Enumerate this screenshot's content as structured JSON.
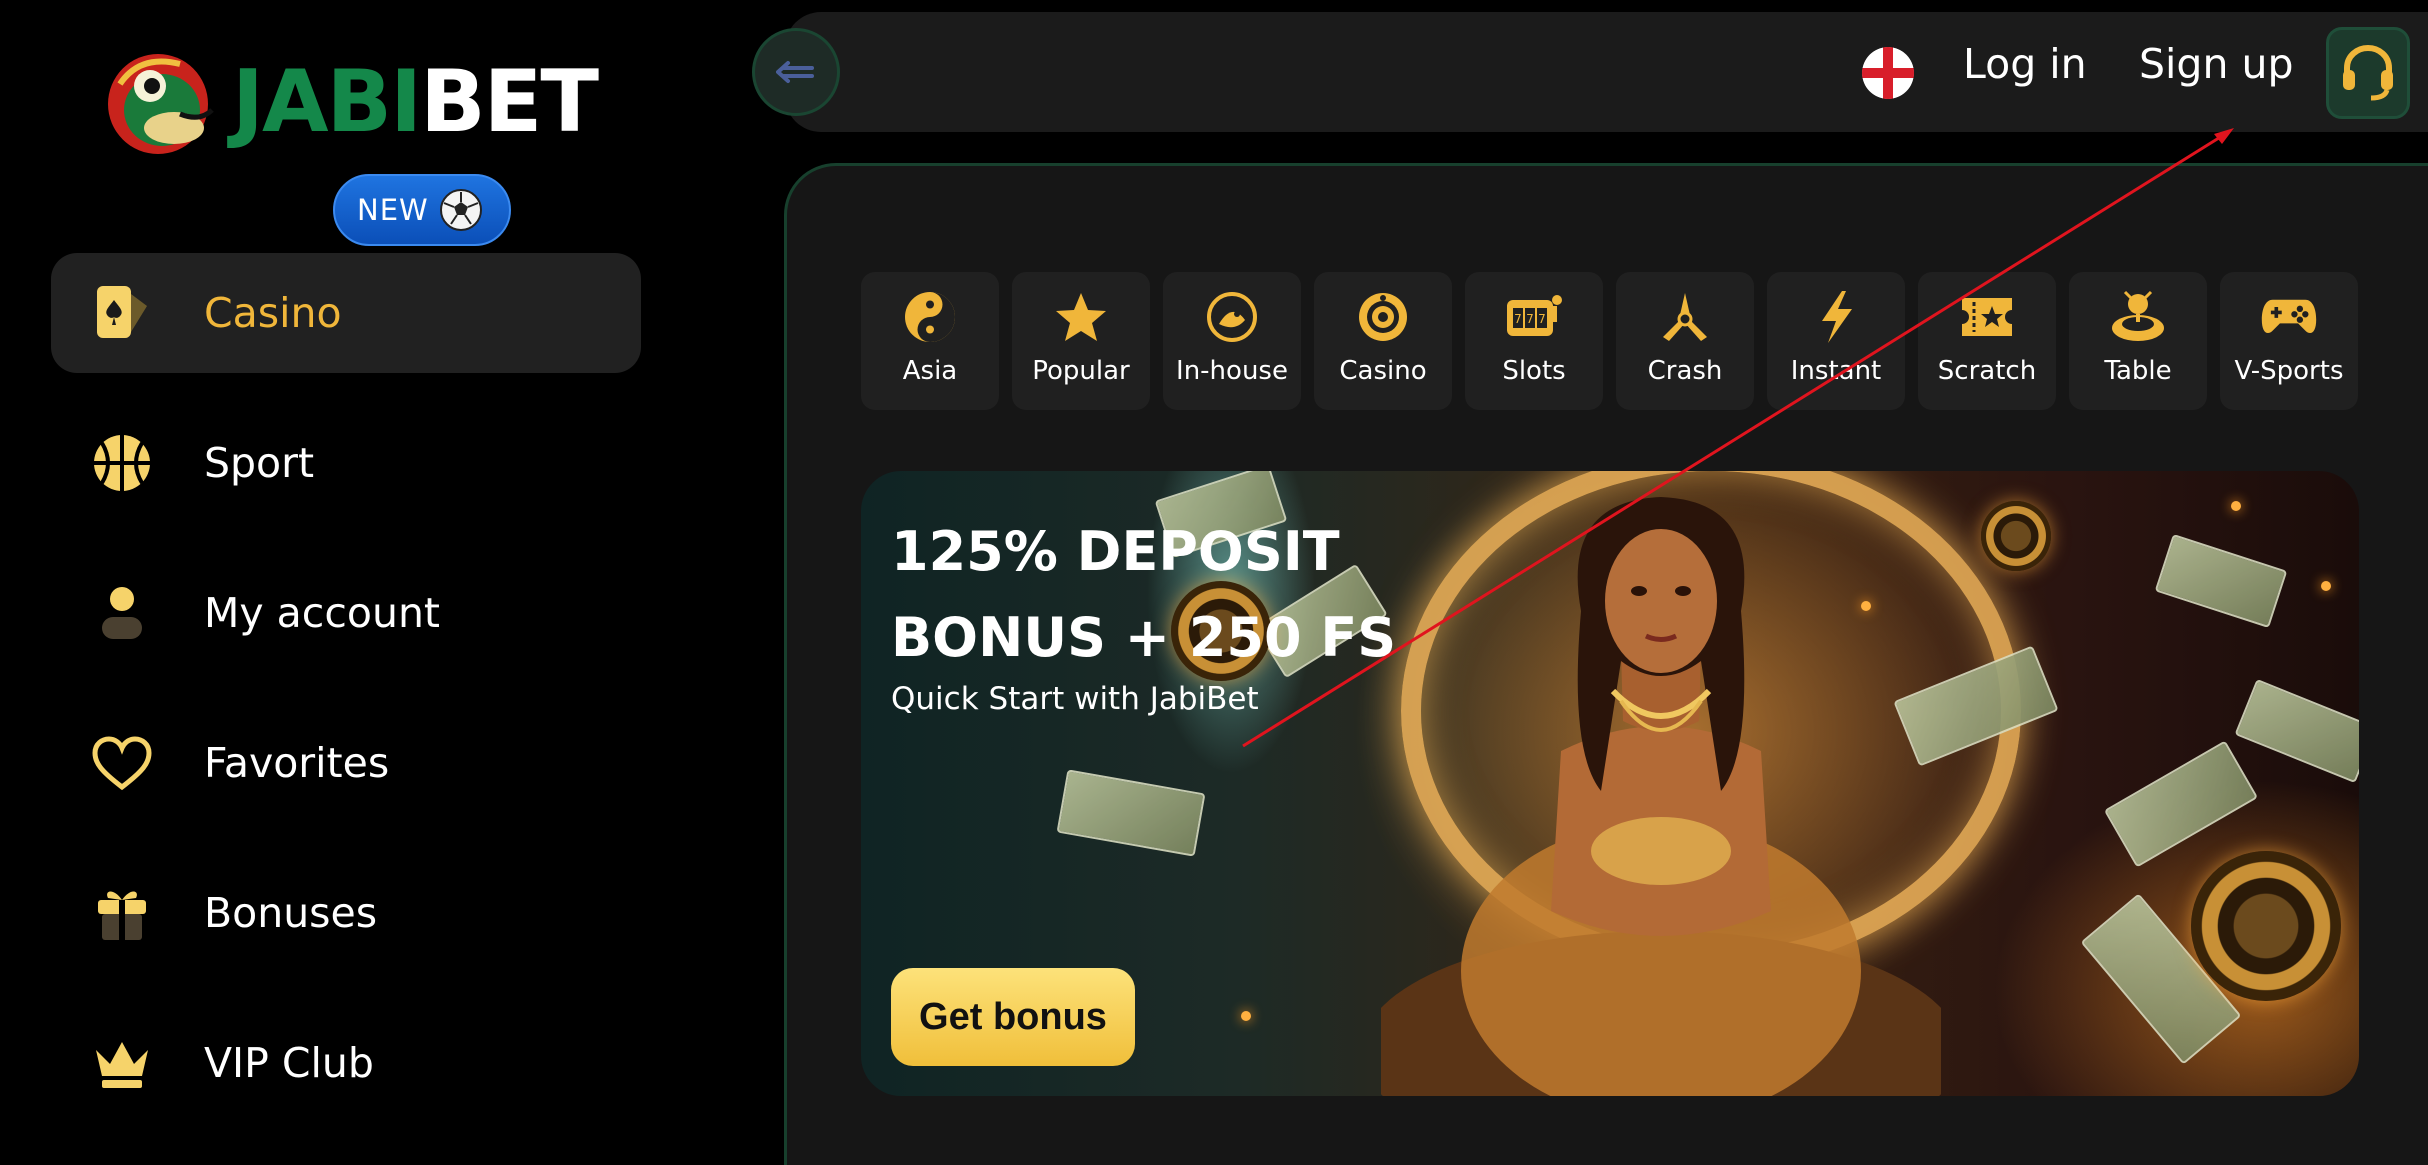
{
  "brand": {
    "name_part1": "JABI",
    "name_part2": "BET"
  },
  "sidebar": {
    "items": [
      {
        "label": "Casino",
        "icon": "card-icon",
        "active": true
      },
      {
        "label": "Sport",
        "icon": "basketball-icon"
      },
      {
        "label": "My account",
        "icon": "user-icon"
      },
      {
        "label": "Favorites",
        "icon": "heart-icon"
      },
      {
        "label": "Bonuses",
        "icon": "gift-icon"
      },
      {
        "label": "VIP Club",
        "icon": "crown-icon"
      }
    ],
    "sport_badge": "NEW"
  },
  "header": {
    "login_label": "Log in",
    "signup_label": "Sign up",
    "language_icon": "england-flag-icon",
    "support_icon": "headset-icon"
  },
  "categories": [
    {
      "label": "Asia",
      "icon": "yin-yang-icon"
    },
    {
      "label": "Popular",
      "icon": "star-icon"
    },
    {
      "label": "In-house",
      "icon": "frog-coin-icon"
    },
    {
      "label": "Casino",
      "icon": "roulette-icon"
    },
    {
      "label": "Slots",
      "icon": "slot-machine-icon"
    },
    {
      "label": "Crash",
      "icon": "propeller-icon"
    },
    {
      "label": "Instant",
      "icon": "lightning-icon"
    },
    {
      "label": "Scratch",
      "icon": "ticket-icon"
    },
    {
      "label": "Table",
      "icon": "table-game-icon"
    },
    {
      "label": "V-Sports",
      "icon": "gamepad-icon"
    }
  ],
  "banner": {
    "title_line1": "125% DEPOSIT",
    "title_line2": "BONUS + 250 FS",
    "subtitle": "Quick Start with JabiBet",
    "button_label": "Get bonus"
  },
  "colors": {
    "accent": "#f0b63a",
    "brand_green": "#14884a",
    "panel": "#161616",
    "border_green": "#17402d",
    "badge_blue": "#1f74e0"
  }
}
